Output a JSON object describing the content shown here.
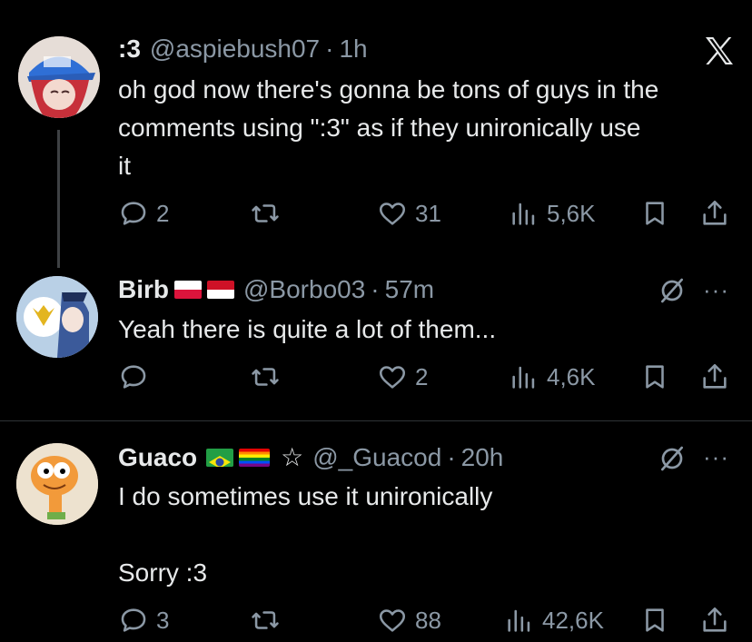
{
  "tweets": [
    {
      "name": ":3",
      "handle": "@aspiebush07",
      "time": "1h",
      "lines": [
        "oh god now there's gonna be tons of guys in the",
        "comments using \":3\" as if they unironically use",
        "it"
      ],
      "replies": "2",
      "retweets": "",
      "likes": "31",
      "views": "5,6K"
    },
    {
      "name": "Birb",
      "handle": "@Borbo03",
      "time": "57m",
      "lines": [
        "Yeah there is quite a lot of them..."
      ],
      "replies": "",
      "retweets": "",
      "likes": "2",
      "views": "4,6K"
    },
    {
      "name": "Guaco",
      "star": "☆",
      "handle": "@_Guacod",
      "time": "20h",
      "lines": [
        "I do sometimes use it unironically",
        "",
        "Sorry :3"
      ],
      "replies": "3",
      "retweets": "",
      "likes": "88",
      "views": "42,6K"
    }
  ],
  "dot": "·",
  "more_label": "···",
  "icons": {
    "reply": "reply-icon",
    "retweet": "retweet-icon",
    "like": "heart-icon",
    "views": "views-icon",
    "bookmark": "bookmark-icon",
    "share": "share-icon",
    "brand": "x-logo-icon",
    "grok": "grok-icon"
  },
  "colors": {
    "background": "#000000",
    "text": "#e7e9ea",
    "muted": "#8b98a5",
    "divider": "#2f3336"
  }
}
